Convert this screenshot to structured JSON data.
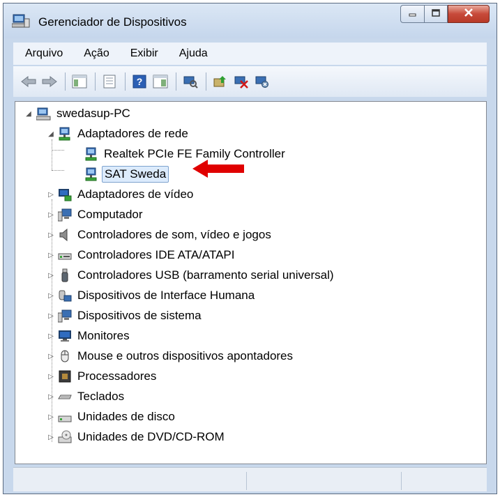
{
  "window": {
    "title": "Gerenciador de Dispositivos",
    "icon": "device-manager-icon",
    "controls": [
      "minimize-icon",
      "maximize-icon",
      "close-icon"
    ]
  },
  "menubar": {
    "items": [
      "Arquivo",
      "Ação",
      "Exibir",
      "Ajuda"
    ]
  },
  "toolbar": {
    "buttons": [
      "back-icon",
      "forward-icon",
      "show-hide-console-tree-icon",
      "properties-icon",
      "help-icon",
      "action-pane-icon",
      "scan-hardware-icon",
      "update-driver-icon",
      "disable-device-icon",
      "uninstall-device-icon"
    ]
  },
  "tree": {
    "root": "swedasup-PC",
    "network_group": "Adaptadores de rede",
    "network_children": [
      "Realtek PCIe FE Family Controller",
      "SAT Sweda"
    ],
    "selected": "SAT Sweda",
    "categories": [
      "Adaptadores de vídeo",
      "Computador",
      "Controladores de som, vídeo e jogos",
      "Controladores IDE ATA/ATAPI",
      "Controladores USB (barramento serial universal)",
      "Dispositivos de Interface Humana",
      "Dispositivos de sistema",
      "Monitores",
      "Mouse e outros dispositivos apontadores",
      "Processadores",
      "Teclados",
      "Unidades de disco",
      "Unidades de DVD/CD-ROM"
    ]
  },
  "colors": {
    "highlight_arrow": "#e00000",
    "selection_bg": "#dcebfc",
    "selection_border": "#7da2ce",
    "title_bar": "#c5d6ec"
  }
}
